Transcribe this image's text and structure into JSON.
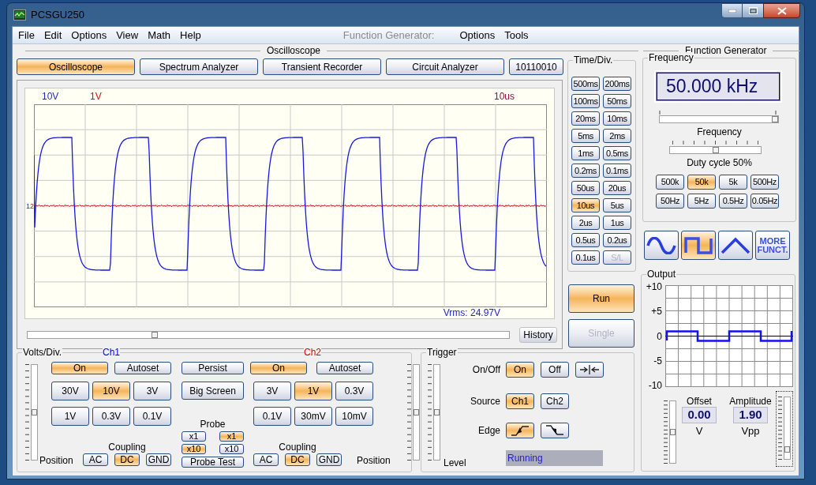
{
  "window": {
    "title": "PCSGU250"
  },
  "menu": [
    "File",
    "Edit",
    "Options",
    "View",
    "Math",
    "Help"
  ],
  "generator_menu": {
    "label": "Function Generator:",
    "items": [
      "Options",
      "Tools"
    ]
  },
  "oscilloscope": {
    "title": "Oscilloscope",
    "modes": [
      {
        "label": "Oscilloscope",
        "selected": true
      },
      {
        "label": "Spectrum Analyzer",
        "selected": false
      },
      {
        "label": "Transient Recorder",
        "selected": false
      },
      {
        "label": "Circuit Analyzer",
        "selected": false
      },
      {
        "label": "10110010",
        "selected": false
      }
    ],
    "screen": {
      "ch1_scale": "10V",
      "ch2_scale": "1V",
      "time_scale": "10us",
      "ch1_marker": "1",
      "ch2_marker": "2",
      "vrms": "Vrms: 24.97V"
    },
    "scroll": {
      "level": 0.26
    },
    "history_button": "History"
  },
  "time_div": {
    "title": "Time/Div.",
    "buttons": [
      {
        "label": "500ms",
        "selected": false,
        "disabled": false
      },
      {
        "label": "200ms",
        "selected": false,
        "disabled": false
      },
      {
        "label": "100ms",
        "selected": false,
        "disabled": false
      },
      {
        "label": "50ms",
        "selected": false,
        "disabled": false
      },
      {
        "label": "20ms",
        "selected": false,
        "disabled": false
      },
      {
        "label": "10ms",
        "selected": false,
        "disabled": false
      },
      {
        "label": "5ms",
        "selected": false,
        "disabled": false
      },
      {
        "label": "2ms",
        "selected": false,
        "disabled": false
      },
      {
        "label": "1ms",
        "selected": false,
        "disabled": false
      },
      {
        "label": "0.5ms",
        "selected": false,
        "disabled": false
      },
      {
        "label": "0.2ms",
        "selected": false,
        "disabled": false
      },
      {
        "label": "0.1ms",
        "selected": false,
        "disabled": false
      },
      {
        "label": "50us",
        "selected": false,
        "disabled": false
      },
      {
        "label": "20us",
        "selected": false,
        "disabled": false
      },
      {
        "label": "10us",
        "selected": true,
        "disabled": false
      },
      {
        "label": "5us",
        "selected": false,
        "disabled": false
      },
      {
        "label": "2us",
        "selected": false,
        "disabled": false
      },
      {
        "label": "1us",
        "selected": false,
        "disabled": false
      },
      {
        "label": "0.5us",
        "selected": false,
        "disabled": false
      },
      {
        "label": "0.2us",
        "selected": false,
        "disabled": false
      },
      {
        "label": "0.1us",
        "selected": false,
        "disabled": false
      },
      {
        "label": "S/L",
        "selected": false,
        "disabled": true
      }
    ]
  },
  "run_controls": [
    {
      "label": "Run",
      "selected": true,
      "disabled": false
    },
    {
      "label": "Single",
      "selected": false,
      "disabled": true
    }
  ],
  "volts_div": {
    "title": "Volts/Div.",
    "channels": [
      {
        "name": "Ch1",
        "color": "#0000ff",
        "on": {
          "label": "On",
          "selected": true
        },
        "autoset": "Autoset",
        "ranges": [
          {
            "label": "30V",
            "selected": false
          },
          {
            "label": "10V",
            "selected": true
          },
          {
            "label": "3V",
            "selected": false
          },
          {
            "label": "1V",
            "selected": false
          },
          {
            "label": "0.3V",
            "selected": false
          },
          {
            "label": "0.1V",
            "selected": false
          }
        ],
        "coupling_label": "Coupling",
        "coupling": [
          {
            "label": "AC",
            "selected": false
          },
          {
            "label": "DC",
            "selected": true
          },
          {
            "label": "GND",
            "selected": false
          }
        ],
        "probe": [
          {
            "label": "x1",
            "selected": false
          },
          {
            "label": "x10",
            "selected": true
          }
        ],
        "position_label": "Position",
        "position": {
          "level": 0.5
        }
      },
      {
        "name": "Ch2",
        "color": "#e00000",
        "on": {
          "label": "On",
          "selected": true
        },
        "autoset": "Autoset",
        "ranges": [
          {
            "label": "3V",
            "selected": false
          },
          {
            "label": "1V",
            "selected": true
          },
          {
            "label": "0.3V",
            "selected": false
          },
          {
            "label": "0.1V",
            "selected": false
          },
          {
            "label": "30mV",
            "selected": false
          },
          {
            "label": "10mV",
            "selected": false
          }
        ],
        "coupling_label": "Coupling",
        "coupling": [
          {
            "label": "AC",
            "selected": false
          },
          {
            "label": "DC",
            "selected": true
          },
          {
            "label": "GND",
            "selected": false
          }
        ],
        "probe": [
          {
            "label": "x1",
            "selected": true
          },
          {
            "label": "x10",
            "selected": false
          }
        ],
        "position_label": "Position",
        "position": {
          "level": 0.5
        }
      }
    ],
    "persist": "Persist",
    "big_screen": "Big Screen",
    "probe_label": "Probe",
    "probe_test": "Probe Test"
  },
  "trigger": {
    "title": "Trigger",
    "rows": [
      {
        "label": "On/Off",
        "buttons": [
          {
            "kind": "text",
            "label": "On",
            "selected": true
          },
          {
            "kind": "text",
            "label": "Off",
            "selected": false
          },
          {
            "kind": "center",
            "selected": false
          }
        ]
      },
      {
        "label": "Source",
        "buttons": [
          {
            "kind": "text",
            "label": "Ch1",
            "selected": true
          },
          {
            "kind": "text",
            "label": "Ch2",
            "selected": false
          }
        ]
      },
      {
        "label": "Edge",
        "buttons": [
          {
            "kind": "rising",
            "selected": true
          },
          {
            "kind": "falling",
            "selected": false
          }
        ]
      }
    ],
    "level_label": "Level",
    "level_slider": {
      "level": 0.5
    },
    "status": "Running"
  },
  "function_generator": {
    "title": "Function Generator",
    "frequency": {
      "title": "Frequency",
      "display": "50.000 kHz",
      "slider": {
        "level": 1
      },
      "slider_label": "Frequency",
      "duty": {
        "level": 0.5
      },
      "duty_label": "Duty cycle 50%",
      "ranges": [
        {
          "label": "500k",
          "selected": false
        },
        {
          "label": "50k",
          "selected": true
        },
        {
          "label": "5k",
          "selected": false
        },
        {
          "label": "500Hz",
          "selected": false
        },
        {
          "label": "50Hz",
          "selected": false
        },
        {
          "label": "5Hz",
          "selected": false
        },
        {
          "label": "0.5Hz",
          "selected": false
        },
        {
          "label": "0.05Hz",
          "selected": false
        }
      ]
    },
    "waveforms": [
      {
        "kind": "sine",
        "selected": false
      },
      {
        "kind": "square",
        "selected": true
      },
      {
        "kind": "triangle",
        "selected": false
      },
      {
        "kind": "more",
        "label": "MORE FUNCT.",
        "selected": false
      }
    ],
    "output": {
      "title": "Output",
      "y_labels": [
        "+10",
        "+5",
        "0",
        "-5",
        "-10"
      ],
      "offset": {
        "label": "Offset",
        "value": "0.00",
        "unit": "V",
        "level": 0.5
      },
      "amplitude": {
        "label": "Amplitude",
        "value": "1.90",
        "unit": "Vpp",
        "level": 0.12
      }
    }
  }
}
